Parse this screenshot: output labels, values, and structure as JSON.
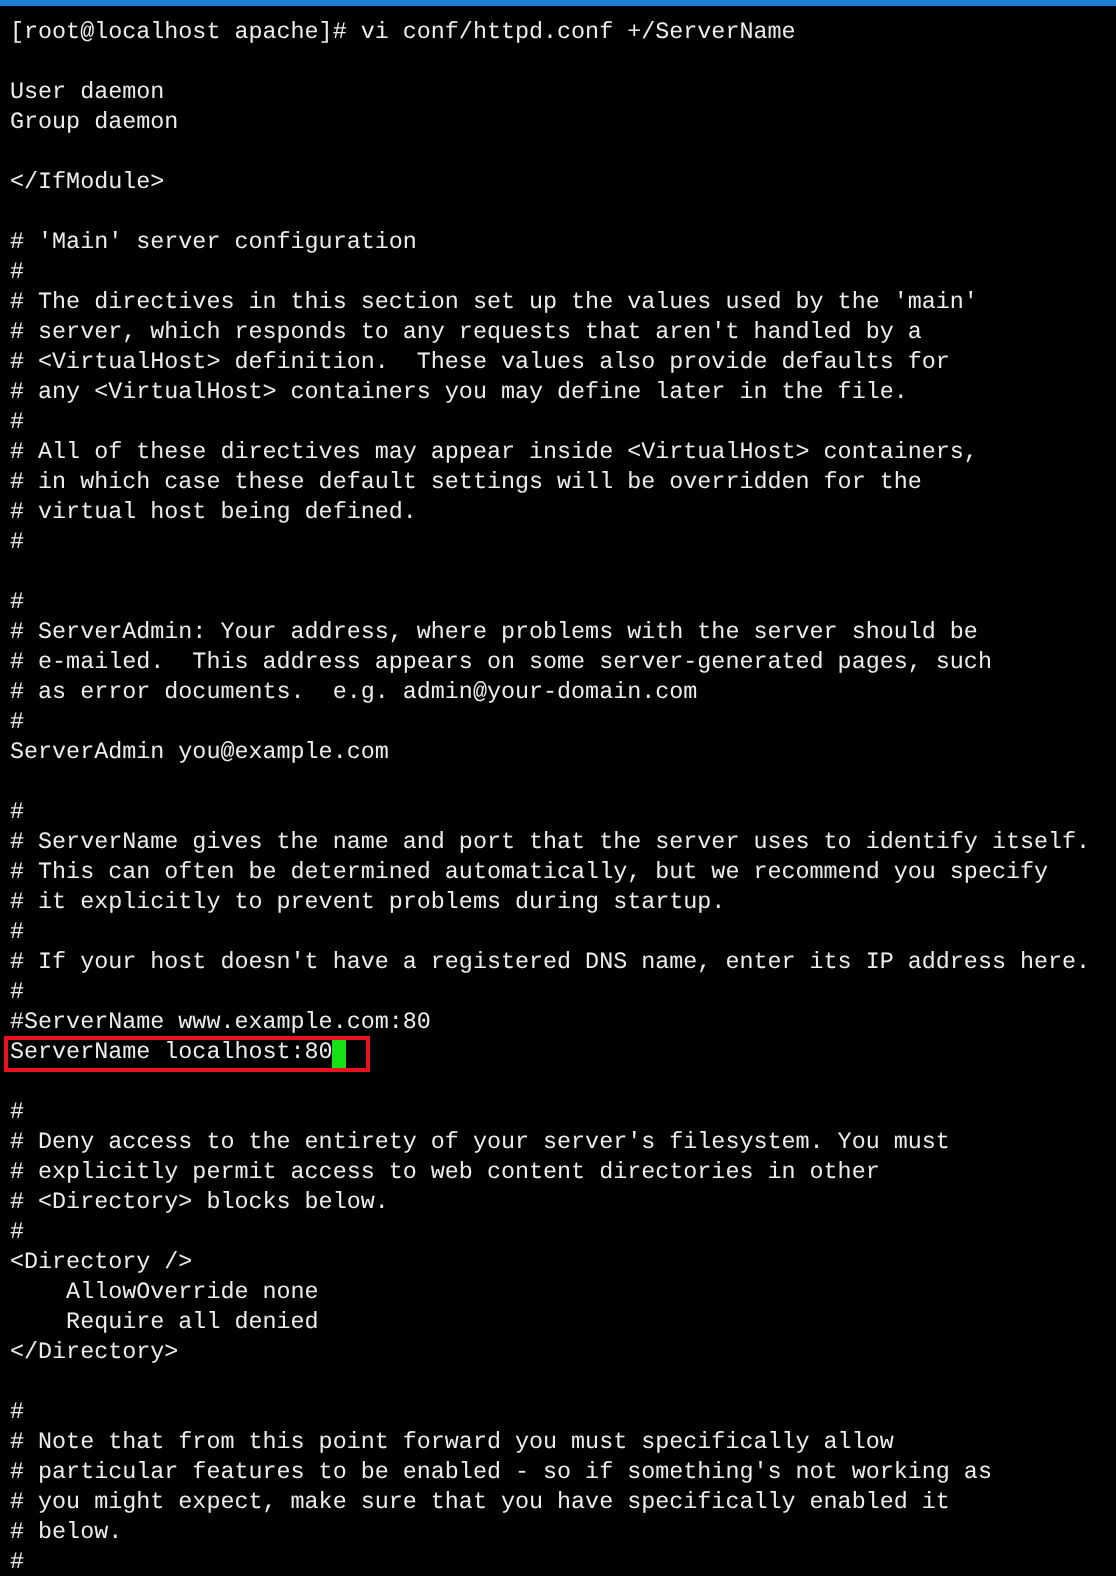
{
  "terminal": {
    "lines": [
      {
        "kind": "text",
        "text": "[root@localhost apache]# vi conf/httpd.conf +/ServerName",
        "boxed": false,
        "cursor": false
      },
      {
        "kind": "blank"
      },
      {
        "kind": "text",
        "text": "User daemon",
        "boxed": false,
        "cursor": false
      },
      {
        "kind": "text",
        "text": "Group daemon",
        "boxed": false,
        "cursor": false
      },
      {
        "kind": "blank"
      },
      {
        "kind": "text",
        "text": "</IfModule>",
        "boxed": false,
        "cursor": false
      },
      {
        "kind": "blank"
      },
      {
        "kind": "text",
        "text": "# 'Main' server configuration",
        "boxed": false,
        "cursor": false
      },
      {
        "kind": "text",
        "text": "#",
        "boxed": false,
        "cursor": false
      },
      {
        "kind": "text",
        "text": "# The directives in this section set up the values used by the 'main'",
        "boxed": false,
        "cursor": false
      },
      {
        "kind": "text",
        "text": "# server, which responds to any requests that aren't handled by a",
        "boxed": false,
        "cursor": false
      },
      {
        "kind": "text",
        "text": "# <VirtualHost> definition.  These values also provide defaults for",
        "boxed": false,
        "cursor": false
      },
      {
        "kind": "text",
        "text": "# any <VirtualHost> containers you may define later in the file.",
        "boxed": false,
        "cursor": false
      },
      {
        "kind": "text",
        "text": "#",
        "boxed": false,
        "cursor": false
      },
      {
        "kind": "text",
        "text": "# All of these directives may appear inside <VirtualHost> containers,",
        "boxed": false,
        "cursor": false
      },
      {
        "kind": "text",
        "text": "# in which case these default settings will be overridden for the",
        "boxed": false,
        "cursor": false
      },
      {
        "kind": "text",
        "text": "# virtual host being defined.",
        "boxed": false,
        "cursor": false
      },
      {
        "kind": "text",
        "text": "#",
        "boxed": false,
        "cursor": false
      },
      {
        "kind": "blank"
      },
      {
        "kind": "text",
        "text": "#",
        "boxed": false,
        "cursor": false
      },
      {
        "kind": "text",
        "text": "# ServerAdmin: Your address, where problems with the server should be",
        "boxed": false,
        "cursor": false
      },
      {
        "kind": "text",
        "text": "# e-mailed.  This address appears on some server-generated pages, such",
        "boxed": false,
        "cursor": false
      },
      {
        "kind": "text",
        "text": "# as error documents.  e.g. admin@your-domain.com",
        "boxed": false,
        "cursor": false
      },
      {
        "kind": "text",
        "text": "#",
        "boxed": false,
        "cursor": false
      },
      {
        "kind": "text",
        "text": "ServerAdmin you@example.com",
        "boxed": false,
        "cursor": false
      },
      {
        "kind": "blank"
      },
      {
        "kind": "text",
        "text": "#",
        "boxed": false,
        "cursor": false
      },
      {
        "kind": "text",
        "text": "# ServerName gives the name and port that the server uses to identify itself.",
        "boxed": false,
        "cursor": false
      },
      {
        "kind": "text",
        "text": "# This can often be determined automatically, but we recommend you specify",
        "boxed": false,
        "cursor": false
      },
      {
        "kind": "text",
        "text": "# it explicitly to prevent problems during startup.",
        "boxed": false,
        "cursor": false
      },
      {
        "kind": "text",
        "text": "#",
        "boxed": false,
        "cursor": false
      },
      {
        "kind": "text",
        "text": "# If your host doesn't have a registered DNS name, enter its IP address here.",
        "boxed": false,
        "cursor": false
      },
      {
        "kind": "text",
        "text": "#",
        "boxed": false,
        "cursor": false
      },
      {
        "kind": "text",
        "text": "#ServerName www.example.com:80",
        "boxed": false,
        "cursor": false
      },
      {
        "kind": "text",
        "text": "ServerName localhost:80",
        "boxed": true,
        "cursor": true
      },
      {
        "kind": "blank"
      },
      {
        "kind": "text",
        "text": "#",
        "boxed": false,
        "cursor": false
      },
      {
        "kind": "text",
        "text": "# Deny access to the entirety of your server's filesystem. You must",
        "boxed": false,
        "cursor": false
      },
      {
        "kind": "text",
        "text": "# explicitly permit access to web content directories in other",
        "boxed": false,
        "cursor": false
      },
      {
        "kind": "text",
        "text": "# <Directory> blocks below.",
        "boxed": false,
        "cursor": false
      },
      {
        "kind": "text",
        "text": "#",
        "boxed": false,
        "cursor": false
      },
      {
        "kind": "text",
        "text": "<Directory />",
        "boxed": false,
        "cursor": false
      },
      {
        "kind": "text",
        "text": "    AllowOverride none",
        "boxed": false,
        "cursor": false
      },
      {
        "kind": "text",
        "text": "    Require all denied",
        "boxed": false,
        "cursor": false
      },
      {
        "kind": "text",
        "text": "</Directory>",
        "boxed": false,
        "cursor": false
      },
      {
        "kind": "blank"
      },
      {
        "kind": "text",
        "text": "#",
        "boxed": false,
        "cursor": false
      },
      {
        "kind": "text",
        "text": "# Note that from this point forward you must specifically allow",
        "boxed": false,
        "cursor": false
      },
      {
        "kind": "text",
        "text": "# particular features to be enabled - so if something's not working as",
        "boxed": false,
        "cursor": false
      },
      {
        "kind": "text",
        "text": "# you might expect, make sure that you have specifically enabled it",
        "boxed": false,
        "cursor": false
      },
      {
        "kind": "text",
        "text": "# below.",
        "boxed": false,
        "cursor": false
      },
      {
        "kind": "text",
        "text": "#",
        "boxed": false,
        "cursor": false
      }
    ]
  }
}
